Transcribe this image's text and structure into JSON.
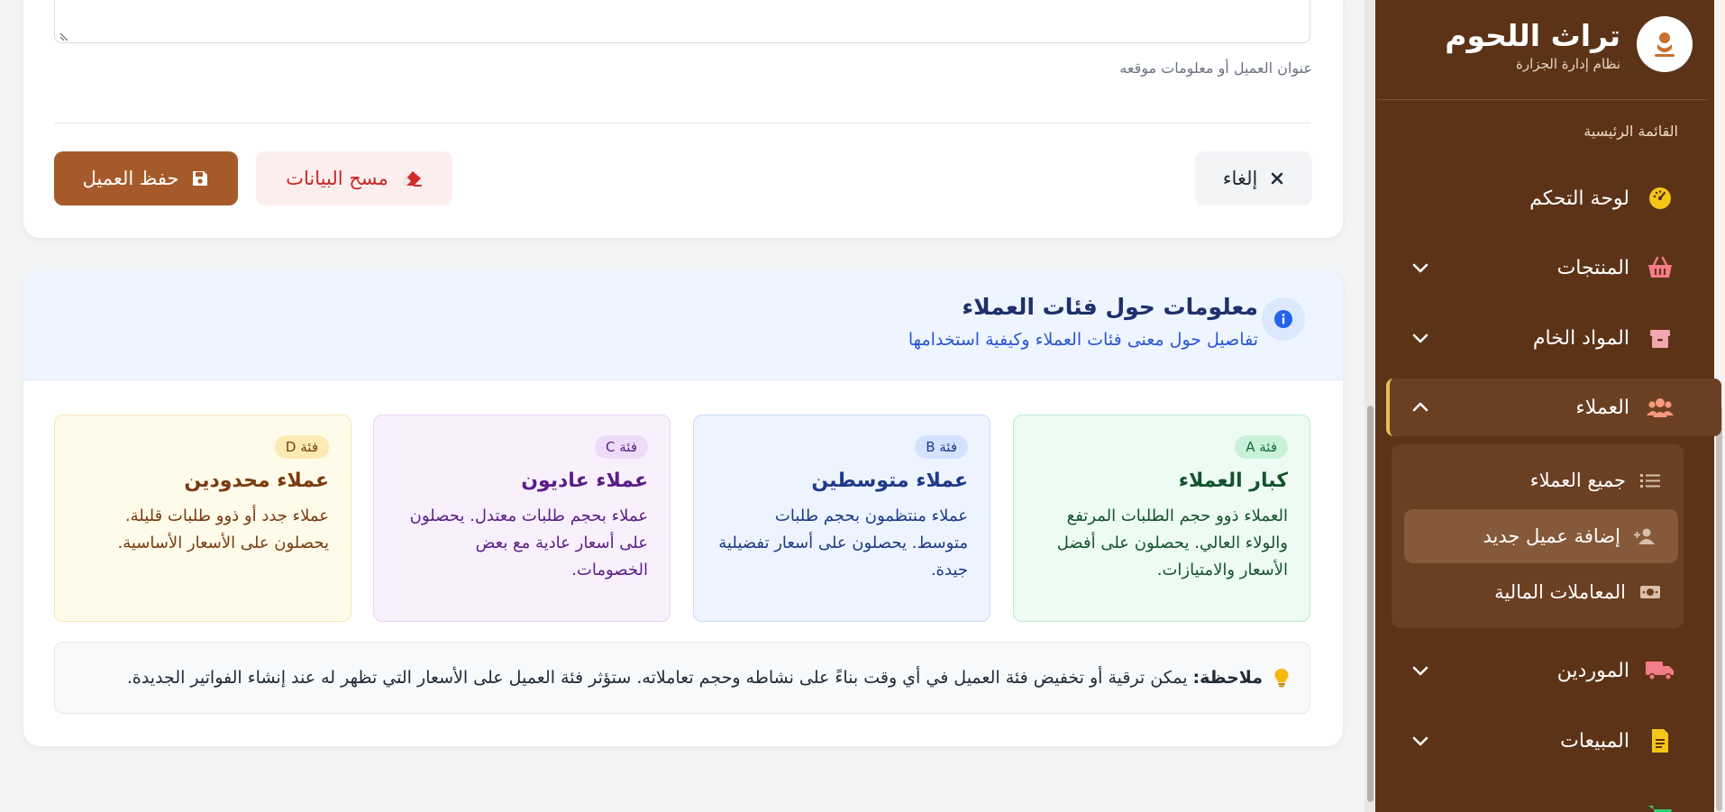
{
  "brand": {
    "title": "تراث اللحوم",
    "subtitle": "نظام إدارة الجزارة"
  },
  "sidebar": {
    "section_label": "القائمة الرئيسية",
    "items": [
      {
        "label": "لوحة التحكم",
        "icon": "gauge-icon"
      },
      {
        "label": "المنتجات",
        "icon": "basket-icon"
      },
      {
        "label": "المواد الخام",
        "icon": "box-icon"
      },
      {
        "label": "العملاء",
        "icon": "users-icon"
      },
      {
        "label": "الموردين",
        "icon": "truck-icon"
      },
      {
        "label": "المبيعات",
        "icon": "invoice-icon"
      }
    ],
    "customers_submenu": [
      {
        "label": "جميع العملاء",
        "icon": "list-icon"
      },
      {
        "label": "إضافة عميل جديد",
        "icon": "user-plus-icon"
      },
      {
        "label": "المعاملات المالية",
        "icon": "money-icon"
      }
    ]
  },
  "form": {
    "address_help": "عنوان العميل أو معلومات موقعه",
    "cancel_label": "إلغاء",
    "clear_label": "مسح البيانات",
    "save_label": "حفظ العميل"
  },
  "info": {
    "title": "معلومات حول فئات العملاء",
    "subtitle": "تفاصيل حول معنى فئات العملاء وكيفية استخدامها",
    "categories": [
      {
        "badge": "فئة A",
        "title": "كبار العملاء",
        "desc": "العملاء ذوو حجم الطلبات المرتفع والولاء العالي. يحصلون على أفضل الأسعار والامتيازات."
      },
      {
        "badge": "فئة B",
        "title": "عملاء متوسطين",
        "desc": "عملاء منتظمون بحجم طلبات متوسط. يحصلون على أسعار تفضيلية جيدة."
      },
      {
        "badge": "فئة C",
        "title": "عملاء عاديون",
        "desc": "عملاء بحجم طلبات معتدل. يحصلون على أسعار عادية مع بعض الخصومات."
      },
      {
        "badge": "فئة D",
        "title": "عملاء محدودين",
        "desc": "عملاء جدد أو ذوو طلبات قليلة. يحصلون على الأسعار الأساسية."
      }
    ],
    "note_label": "ملاحظة:",
    "note_text": "يمكن ترقية أو تخفيض فئة العميل في أي وقت بناءً على نشاطه وحجم تعاملاته. ستؤثر فئة العميل على الأسعار التي تظهر له عند إنشاء الفواتير الجديدة."
  },
  "colors": {
    "sidebar_bg": "#5c3317",
    "accent": "#a65a2b",
    "active_border": "#e6c050"
  }
}
